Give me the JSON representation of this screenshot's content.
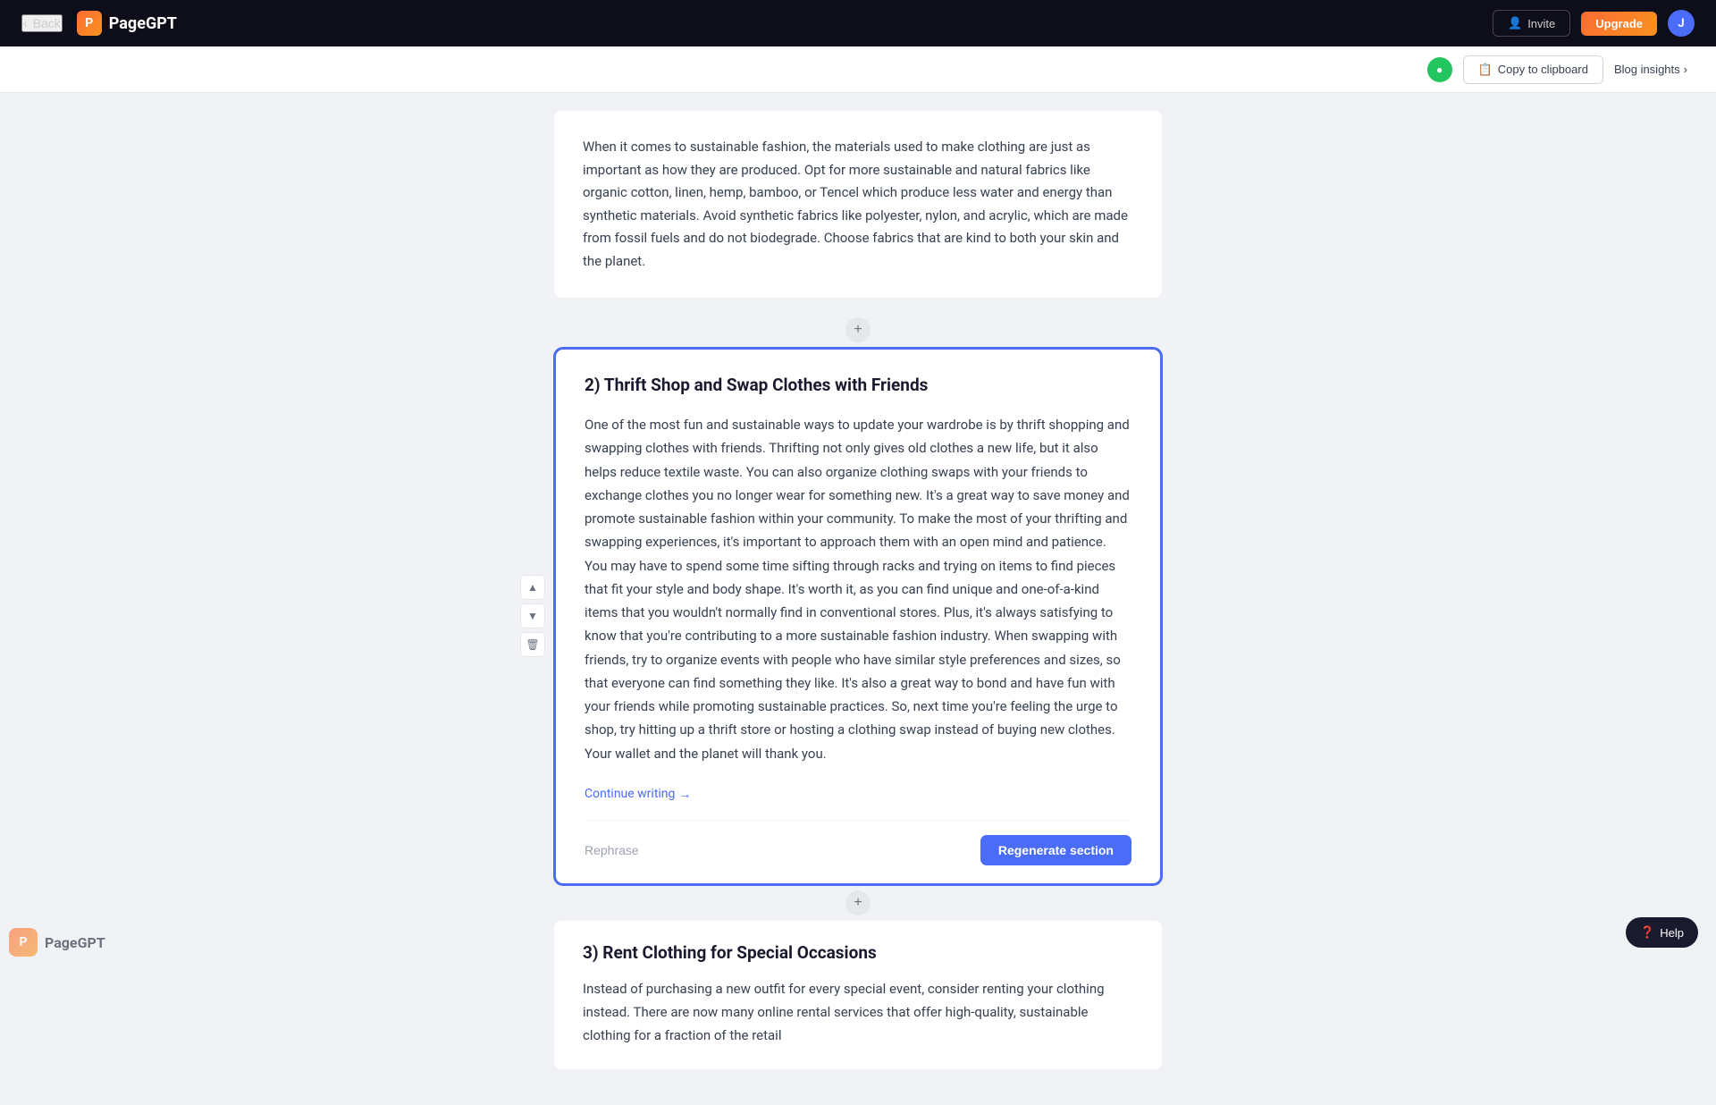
{
  "nav": {
    "back_label": "Back",
    "logo_text": "PageGPT",
    "logo_icon": "P",
    "invite_label": "Invite",
    "upgrade_label": "Upgrade",
    "user_initial": "J"
  },
  "toolbar": {
    "copy_clipboard_label": "Copy to clipboard",
    "blog_insights_label": "Blog insights",
    "chevron_right": "›"
  },
  "watermark": {
    "text": "PageG"
  },
  "intro_block": {
    "text": "When it comes to sustainable fashion, the materials used to make clothing are just as important as how they are produced. Opt for more sustainable and natural fabrics like organic cotton, linen, hemp, bamboo, or Tencel which produce less water and energy than synthetic materials. Avoid synthetic fabrics like polyester, nylon, and acrylic, which are made from fossil fuels and do not biodegrade. Choose fabrics that are kind to both your skin and the planet."
  },
  "section2": {
    "title": "2) Thrift Shop and Swap Clothes with Friends",
    "body": "One of the most fun and sustainable ways to update your wardrobe is by thrift shopping and swapping clothes with friends. Thrifting not only gives old clothes a new life, but it also helps reduce textile waste. You can also organize clothing swaps with your friends to exchange clothes you no longer wear for something new. It's a great way to save money and promote sustainable fashion within your community. To make the most of your thrifting and swapping experiences, it's important to approach them with an open mind and patience. You may have to spend some time sifting through racks and trying on items to find pieces that fit your style and body shape. It's worth it, as you can find unique and one-of-a-kind items that you wouldn't normally find in conventional stores. Plus, it's always satisfying to know that you're contributing to a more sustainable fashion industry. When swapping with friends, try to organize events with people who have similar style preferences and sizes, so that everyone can find something they like. It's also a great way to bond and have fun with your friends while promoting sustainable practices. So, next time you're feeling the urge to shop, try hitting up a thrift store or hosting a clothing swap instead of buying new clothes. Your wallet and the planet will thank you.",
    "continue_writing_label": "Continue writing",
    "continue_writing_arrow": "→",
    "rephrase_label": "Rephrase",
    "regenerate_label": "Regenerate section"
  },
  "section3": {
    "title": "3) Rent Clothing for Special Occasions",
    "body": "Instead of purchasing a new outfit for every special event, consider renting your clothing instead. There are now many online rental services that offer high-quality, sustainable clothing for a fraction of the retail"
  },
  "side_controls": {
    "up_arrow": "▲",
    "down_arrow": "▼",
    "delete_icon": "🗑"
  },
  "help": {
    "label": "Help"
  },
  "bottom_logo": {
    "icon": "P",
    "text": "PageGPT"
  },
  "colors": {
    "accent": "#4a6cf7",
    "orange": "#ff6b35",
    "green": "#22c55e"
  }
}
